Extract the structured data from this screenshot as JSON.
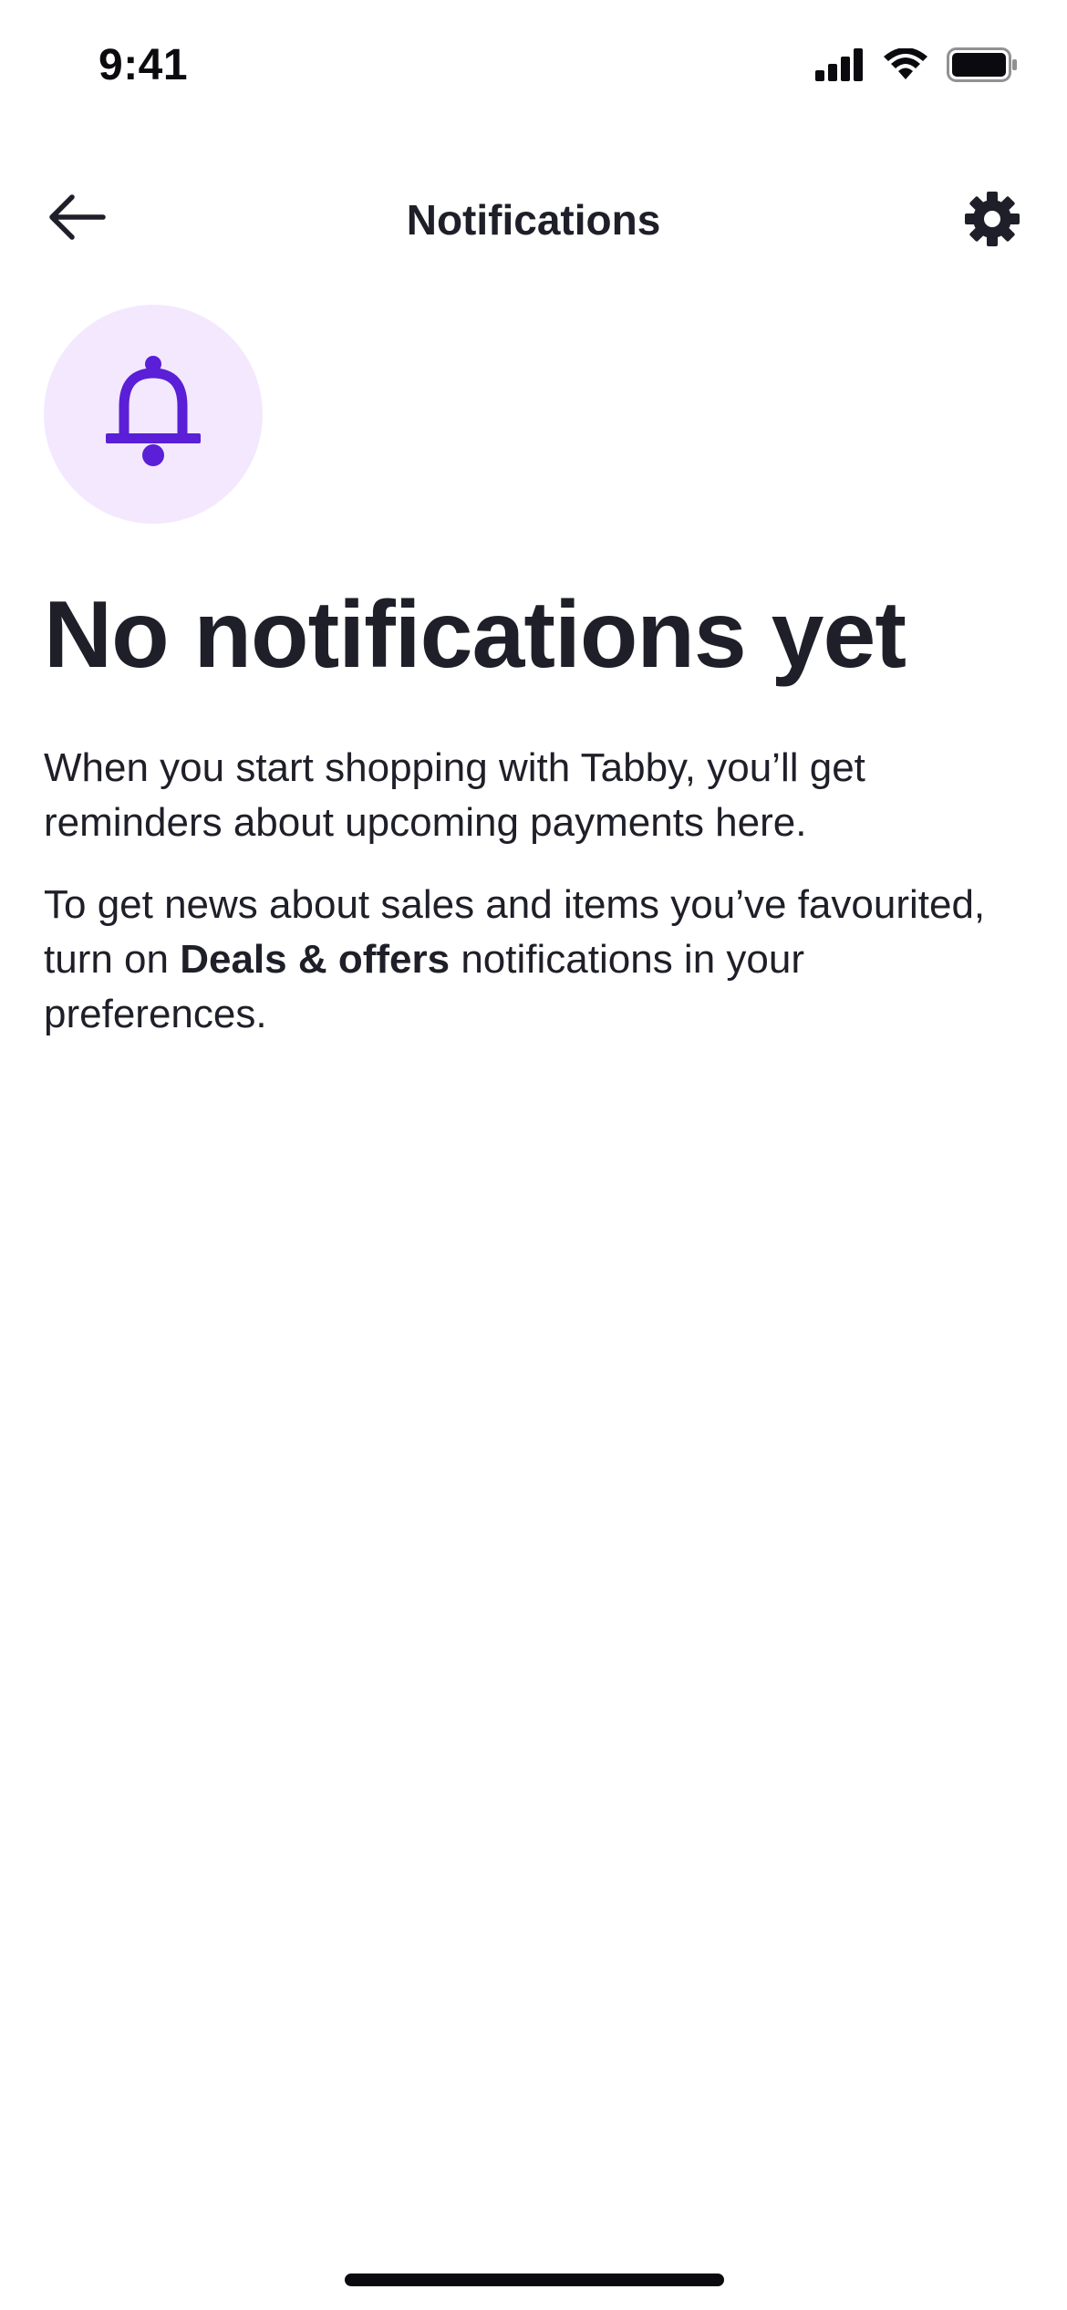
{
  "status_bar": {
    "time": "9:41"
  },
  "nav": {
    "title": "Notifications",
    "back_icon": "arrow-left-icon",
    "settings_icon": "gear-icon"
  },
  "empty_state": {
    "icon": "bell-icon",
    "heading": "No notifications yet",
    "paragraph_1": "When you start shopping with Tabby, you’ll get reminders about upcoming payments here.",
    "paragraph_2_before": "To get news about sales and items you’ve favourited, turn on ",
    "paragraph_2_bold": "Deals & offers",
    "paragraph_2_after": " notifications in your preferences."
  },
  "colors": {
    "text": "#1f1f29",
    "accent": "#5a1fd6",
    "icon_circle_bg": "#f3e8fe",
    "background": "#ffffff"
  }
}
